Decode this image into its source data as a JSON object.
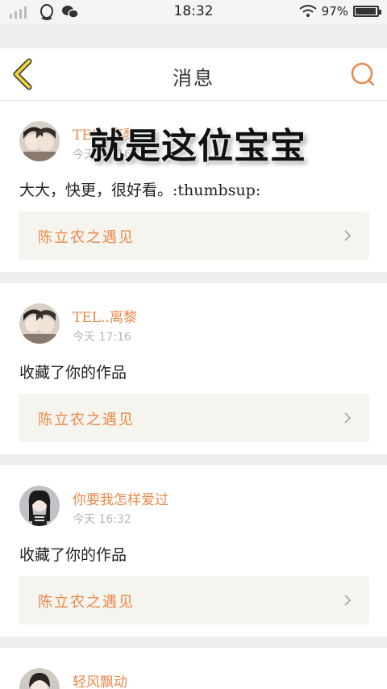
{
  "statusbar": {
    "time": "18:32",
    "battery": "97%",
    "battery_level": 0.97,
    "icons": [
      "signal-icon",
      "qq-icon",
      "wechat-icon",
      "wifi-icon",
      "battery-icon"
    ]
  },
  "header": {
    "title": "消息",
    "back_icon": "back-chevron-icon",
    "search_icon": "search-icon"
  },
  "overlay_text": "就是这位宝宝",
  "messages": [
    {
      "name": "TEL..离黎",
      "time": "今天 17:16",
      "content": "大大，快更，很好看。:thumbsup:",
      "work": "陈立农之遇见"
    },
    {
      "name": "TEL..离黎",
      "time": "今天 17:16",
      "content": "收藏了你的作品",
      "work": "陈立农之遇见"
    },
    {
      "name": "你要我怎样爱过",
      "time": "今天 16:32",
      "content": "收藏了你的作品",
      "work": "陈立农之遇见"
    },
    {
      "name": "轻风飘动",
      "time": "",
      "content": "",
      "work": ""
    }
  ],
  "colors": {
    "accent": "#e8894a",
    "back_icon": "#e8c21a",
    "work_bg": "#f5f4ee",
    "page_bg": "#f0efed"
  }
}
